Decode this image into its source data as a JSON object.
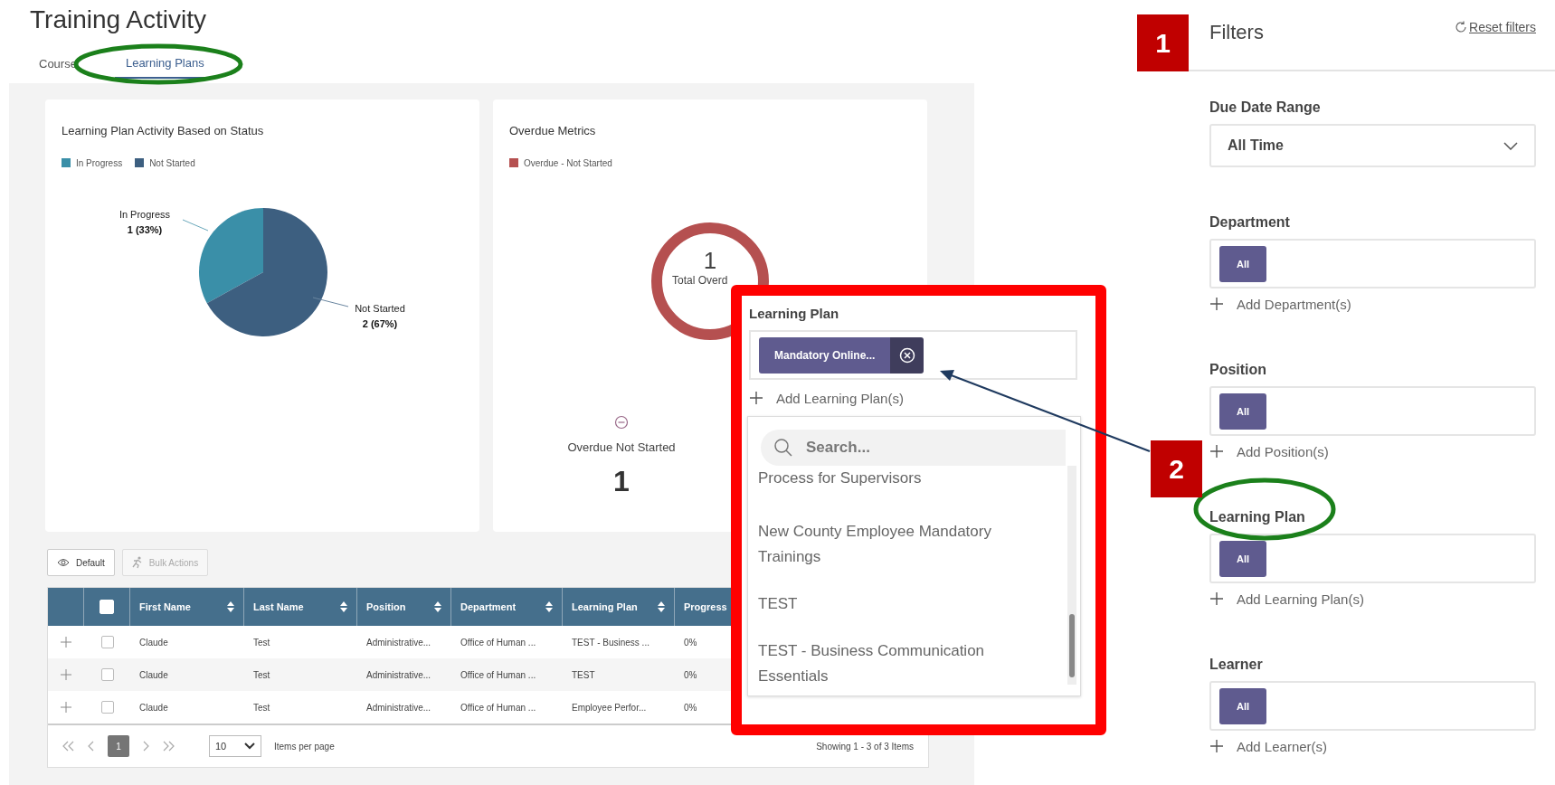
{
  "page": {
    "title": "Training Activity"
  },
  "tabs": [
    {
      "label": "Course",
      "selected": false
    },
    {
      "label": "Learning Plans",
      "selected": true
    }
  ],
  "status_card": {
    "title": "Learning Plan Activity Based on Status",
    "legend": [
      {
        "color": "#3a8fa8"
      },
      {
        "color": "#3d5f80"
      }
    ],
    "chart_data": {
      "type": "pie",
      "categories": [
        "In Progress",
        "Not Started"
      ],
      "series": [
        {
          "values": [
            33,
            67
          ]
        }
      ],
      "value_labels": [
        "1 (33%)",
        "2 (67%)"
      ]
    }
  },
  "overdue_card": {
    "title": "Overdue Metrics",
    "legend": [
      {
        "label": "Overdue - Not Started",
        "color": "#b55050"
      }
    ],
    "total": "1",
    "total_label": "Total Overd",
    "metric_label": "Overdue Not Started",
    "metric_value": "1"
  },
  "toolbar": [
    {
      "label": "Default",
      "disabled": false
    },
    {
      "label": "Bulk Actions",
      "disabled": true
    }
  ],
  "table": {
    "header_checked": false,
    "columns": [
      "First Name",
      "Last Name",
      "Position",
      "Department",
      "Learning Plan",
      "Progress"
    ],
    "rows": [
      {
        "checked": false,
        "cells": [
          "Claude",
          "Test",
          "Administrative...",
          "Office of Human ...",
          "TEST - Business ...",
          "0%"
        ]
      },
      {
        "checked": false,
        "cells": [
          "Claude",
          "Test",
          "Administrative...",
          "Office of Human ...",
          "TEST",
          "0%"
        ]
      },
      {
        "checked": false,
        "cells": [
          "Claude",
          "Test",
          "Administrative...",
          "Office of Human ...",
          "Employee Perfor...",
          "0%"
        ]
      }
    ]
  },
  "pagination": {
    "pages": [
      {
        "label": "1",
        "selected": true
      }
    ],
    "page_size": "10",
    "page_size_label": "Items per page",
    "summary": "Showing 1 - 3 of 3 Items"
  },
  "callout": {
    "label": "Learning Plan",
    "chips": [
      "Mandatory Online..."
    ],
    "add": "Add Learning Plan(s)",
    "placeholder": "Search...",
    "options": [
      "Process for Supervisors",
      "New County Employee Mandatory Trainings",
      "TEST",
      "TEST - Business Communication Essentials"
    ]
  },
  "filters": {
    "title": "Filters",
    "reset": "Reset filters",
    "sections": [
      {
        "kind": "select",
        "label": "Due Date Range",
        "value": "All Time"
      },
      {
        "kind": "chips",
        "label": "Department",
        "chips": [
          "All"
        ],
        "add": "Add Department(s)"
      },
      {
        "kind": "chips",
        "label": "Position",
        "chips": [
          "All"
        ],
        "add": "Add Position(s)"
      },
      {
        "kind": "chips",
        "label": "Learning Plan",
        "chips": [
          "All"
        ],
        "add": "Add Learning Plan(s)"
      },
      {
        "kind": "chips",
        "label": "Learner",
        "chips": [
          "All"
        ],
        "add": "Add Learner(s)"
      }
    ]
  },
  "annotations": {
    "badges": [
      "1",
      "2"
    ]
  }
}
